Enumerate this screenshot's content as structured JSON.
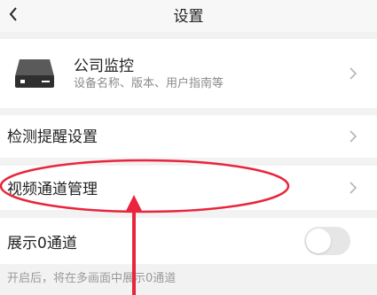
{
  "header": {
    "title": "设置",
    "back_icon": "chevron-left-icon"
  },
  "device": {
    "name": "公司监控",
    "description": "设备名称、版本、用户指南等",
    "icon": "nvr-device-icon"
  },
  "menu": {
    "alert_settings": "检测提醒设置",
    "channel_management": "视频通道管理"
  },
  "show_channel0": {
    "label": "展示0通道",
    "enabled": false,
    "hint": "开启后，将在多画面中展示0通道"
  },
  "colors": {
    "annotation": "#e8253c",
    "background": "#f2f2f2"
  }
}
